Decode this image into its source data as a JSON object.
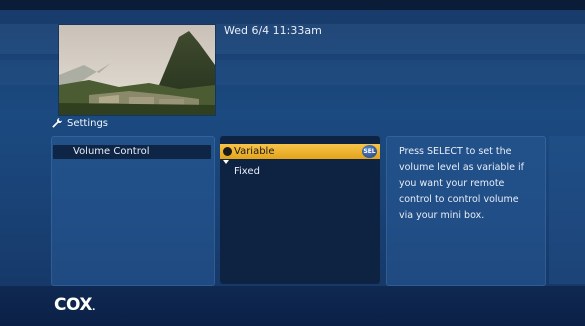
{
  "header": {
    "datetime": "Wed 6/4  11:33am"
  },
  "breadcrumb": {
    "icon": "wrench-icon",
    "label": "Settings"
  },
  "menu": {
    "selected_item": "Volume Control"
  },
  "options": [
    {
      "label": "Variable",
      "selected": true,
      "badge": "SEL"
    },
    {
      "label": "Fixed",
      "selected": false
    }
  ],
  "help_lines": [
    "Press SELECT to set the",
    "volume level as variable if",
    "you want your remote",
    "control to control volume",
    "via your mini box."
  ],
  "brand": {
    "logo_text": "COX",
    "logo_dot": "."
  },
  "colors": {
    "highlight": "#e9a825",
    "background": "#1b4a80",
    "panel_dark": "#0e2342"
  },
  "preview_image": {
    "description_icon": "mountain-landscape-image"
  }
}
